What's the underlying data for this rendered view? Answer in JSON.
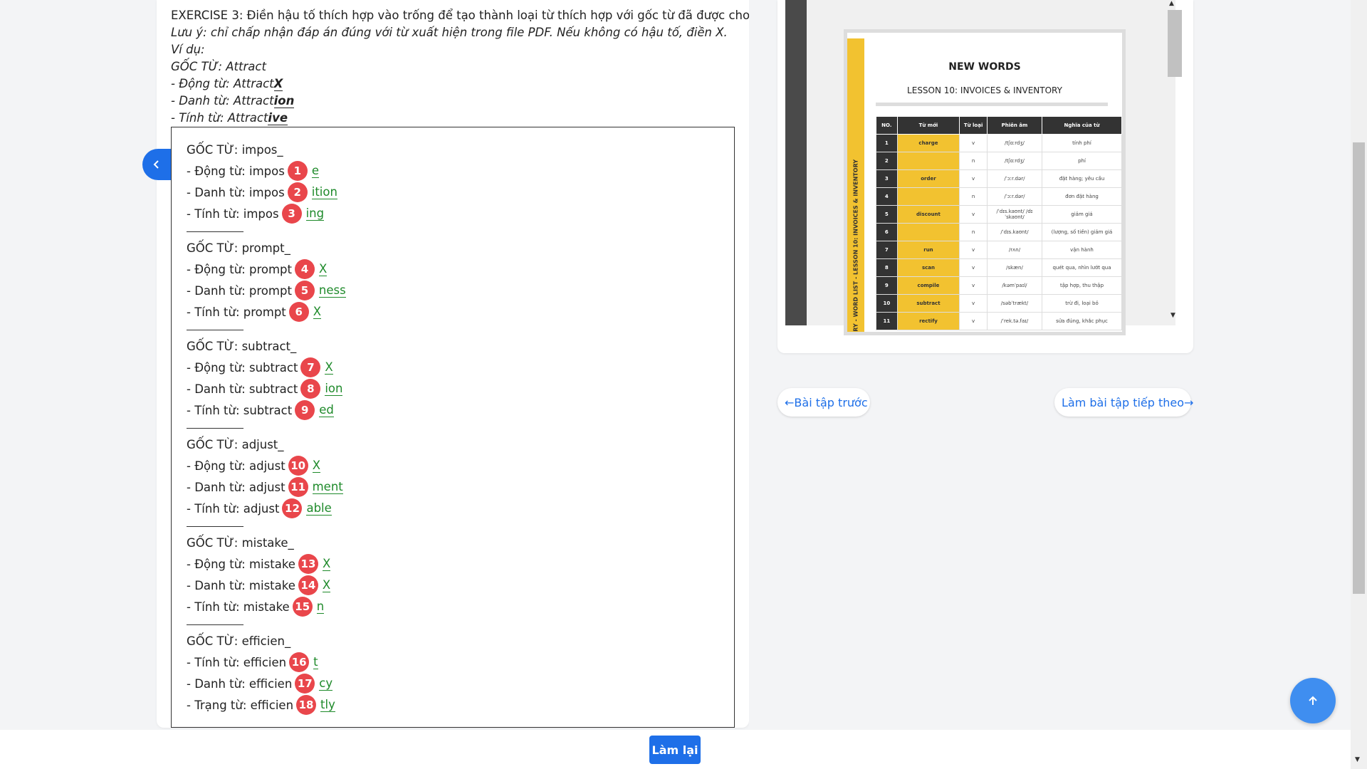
{
  "instructions": {
    "line1": "EXERCISE 3: Điền hậu tố thích hợp vào trống để tạo thành loại từ thích hợp với gốc từ đã được cho sẵn.",
    "line2": "Lưu ý: chỉ chấp nhận đáp án đúng với từ xuất hiện trong file PDF. Nếu không có hậu tố, điền X.",
    "line3": "Ví dụ:",
    "line4": "GỐC TỪ: Attract",
    "ex_verb_prefix": "- Động từ: Attract",
    "ex_verb_suffix": "X",
    "ex_noun_prefix": "- Danh từ: Attract",
    "ex_noun_suffix": "ion",
    "ex_adj_prefix": "- Tính từ: Attract",
    "ex_adj_suffix": "ive"
  },
  "separator": "__________",
  "groups": [
    {
      "root": "GỐC TỪ: impos_",
      "items": [
        {
          "label": "- Động từ: impos",
          "num": "1",
          "answer": "e"
        },
        {
          "label": "- Danh từ: impos",
          "num": "2",
          "answer": "ition"
        },
        {
          "label": "- Tính từ: impos",
          "num": "3",
          "answer": "ing"
        }
      ]
    },
    {
      "root": "GỐC TỪ: prompt_",
      "items": [
        {
          "label": "- Động từ: prompt",
          "num": "4",
          "answer": "X"
        },
        {
          "label": "- Danh từ: prompt",
          "num": "5",
          "answer": "ness"
        },
        {
          "label": "- Tính từ: prompt",
          "num": "6",
          "answer": "X"
        }
      ]
    },
    {
      "root": "GỐC TỪ: subtract_",
      "items": [
        {
          "label": "- Động từ: subtract",
          "num": "7",
          "answer": "X"
        },
        {
          "label": "- Danh từ: subtract",
          "num": "8",
          "answer": "ion"
        },
        {
          "label": "- Tính từ: subtract",
          "num": "9",
          "answer": "ed"
        }
      ]
    },
    {
      "root": "GỐC TỪ: adjust_",
      "items": [
        {
          "label": "- Động từ: adjust",
          "num": "10",
          "answer": "X"
        },
        {
          "label": "- Danh từ: adjust",
          "num": "11",
          "answer": "ment"
        },
        {
          "label": "- Tính từ: adjust",
          "num": "12",
          "answer": "able"
        }
      ]
    },
    {
      "root": "GỐC TỪ: mistake_",
      "items": [
        {
          "label": "- Động từ: mistake",
          "num": "13",
          "answer": "X"
        },
        {
          "label": "- Danh từ: mistake",
          "num": "14",
          "answer": "X"
        },
        {
          "label": "- Tính từ: mistake",
          "num": "15",
          "answer": "n"
        }
      ]
    },
    {
      "root": "GỐC TỪ: efficien_",
      "items": [
        {
          "label": "- Tính từ: efficien",
          "num": "16",
          "answer": "t"
        },
        {
          "label": "- Danh từ: efficien",
          "num": "17",
          "answer": "cy"
        },
        {
          "label": "- Trạng từ: efficien",
          "num": "18",
          "answer": "tly"
        }
      ]
    }
  ],
  "pdf": {
    "title": "NEW WORDS",
    "subtitle": "LESSON 10: INVOICES & INVENTORY",
    "sidebar_text": "OCABULARY - WORD LIST - LESSON 10: INVOICES & INVENTORY",
    "headers": [
      "NO.",
      "Từ mới",
      "Từ loại",
      "Phiên âm",
      "Nghĩa của từ"
    ],
    "rows": [
      {
        "no": "1",
        "word": "charge",
        "pos": "v",
        "ipa": "/tʃɑːrdʒ/",
        "meaning": "tính phí"
      },
      {
        "no": "2",
        "word": "",
        "pos": "n",
        "ipa": "/tʃɑːrdʒ/",
        "meaning": "phí"
      },
      {
        "no": "3",
        "word": "order",
        "pos": "v",
        "ipa": "/ˈɔːr.dər/",
        "meaning": "đặt hàng; yêu cầu"
      },
      {
        "no": "4",
        "word": "",
        "pos": "n",
        "ipa": "/ˈɔːr.dər/",
        "meaning": "đơn đặt hàng"
      },
      {
        "no": "5",
        "word": "discount",
        "pos": "v",
        "ipa": "/ˈdɪs.kaʊnt/ /dɪˈskaʊnt/",
        "meaning": "giảm giá"
      },
      {
        "no": "6",
        "word": "",
        "pos": "n",
        "ipa": "/ˈdɪs.kaʊnt/",
        "meaning": "(lượng, số tiền) giảm giá"
      },
      {
        "no": "7",
        "word": "run",
        "pos": "v",
        "ipa": "/rʌn/",
        "meaning": "vận hành"
      },
      {
        "no": "8",
        "word": "scan",
        "pos": "v",
        "ipa": "/skæn/",
        "meaning": "quét qua, nhìn lướt qua"
      },
      {
        "no": "9",
        "word": "compile",
        "pos": "v",
        "ipa": "/kəmˈpaɪl/",
        "meaning": "tập hợp, thu thập"
      },
      {
        "no": "10",
        "word": "subtract",
        "pos": "v",
        "ipa": "/səbˈtrækt/",
        "meaning": "trừ đi, loại bỏ"
      },
      {
        "no": "11",
        "word": "rectify",
        "pos": "v",
        "ipa": "/ˈrek.tə.faɪ/",
        "meaning": "sửa đúng, khắc phục"
      }
    ]
  },
  "nav": {
    "prev_label": "←Bài tập trước",
    "next_label": "Làm bài tập tiếp theo→"
  },
  "reset_label": "Làm lại",
  "icons": {
    "collapse": "chevron-left-icon",
    "fab": "arrow-up-icon"
  },
  "colors": {
    "primary": "#1e6fe8",
    "badge": "#e9464b",
    "answer": "#1e8a2a",
    "pdf_accent": "#f2c230"
  }
}
